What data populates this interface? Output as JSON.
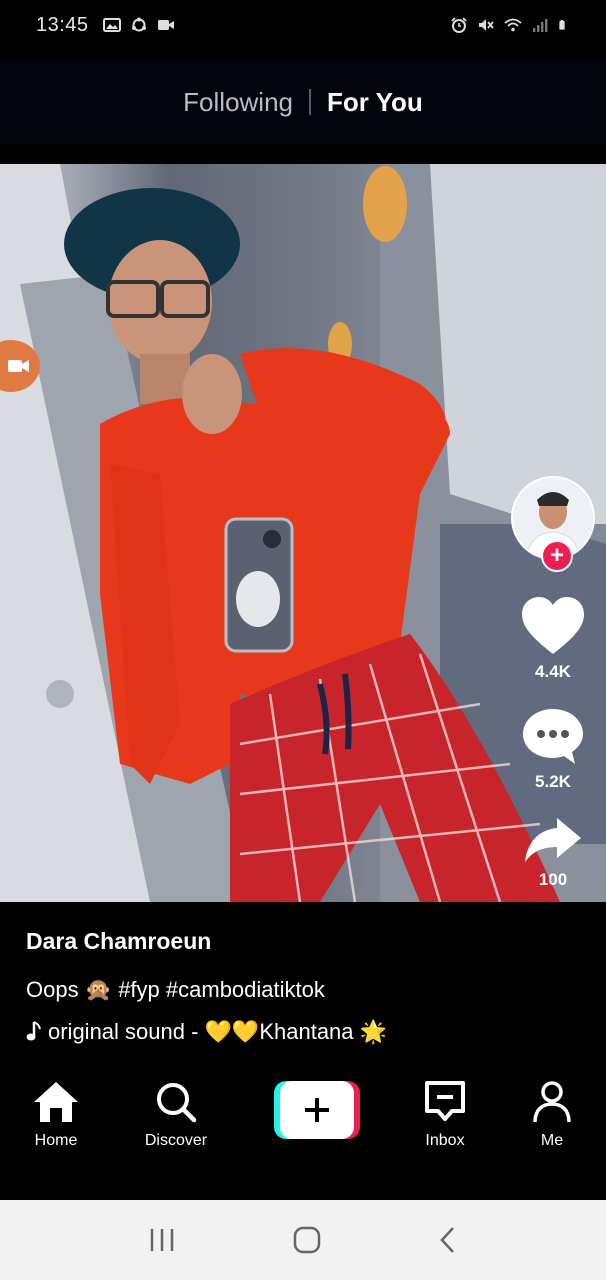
{
  "status_bar": {
    "time": "13:45",
    "left_icons": [
      "gallery-icon",
      "sync-icon",
      "video-icon"
    ],
    "right_icons": [
      "alarm-icon",
      "mute-icon",
      "wifi-icon",
      "signal-icon",
      "battery-icon"
    ]
  },
  "top_tabs": {
    "following": "Following",
    "for_you": "For You",
    "active": "For You"
  },
  "actions": {
    "likes": "4.4K",
    "comments": "5.2K",
    "shares": "100"
  },
  "post": {
    "author": "Dara Chamroeun",
    "caption": "Oops 🙊 #fyp #cambodiatiktok",
    "sound": "original sound - 💛💛Khantana 🌟"
  },
  "bottom_nav": {
    "home": "Home",
    "discover": "Discover",
    "inbox": "Inbox",
    "me": "Me"
  },
  "colors": {
    "accent_red": "#ee1d52",
    "accent_cyan": "#25f4ee",
    "background": "#000000"
  }
}
